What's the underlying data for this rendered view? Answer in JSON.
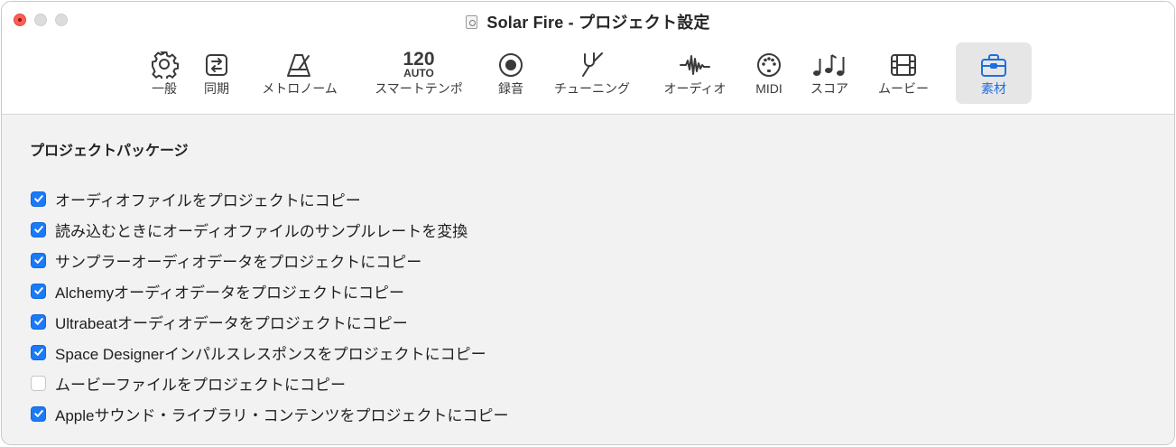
{
  "window": {
    "title": "Solar Fire - プロジェクト設定"
  },
  "toolbar": {
    "tempo_number": "120",
    "tempo_mode": "AUTO",
    "items": [
      {
        "label": "一般",
        "icon": "gear-icon"
      },
      {
        "label": "同期",
        "icon": "sync-icon"
      },
      {
        "label": "メトロノーム",
        "icon": "metronome-icon"
      },
      {
        "label": "スマートテンポ",
        "icon": "smart-tempo-icon"
      },
      {
        "label": "録音",
        "icon": "record-icon"
      },
      {
        "label": "チューニング",
        "icon": "tuning-fork-icon"
      },
      {
        "label": "オーディオ",
        "icon": "waveform-icon"
      },
      {
        "label": "MIDI",
        "icon": "midi-connector-icon"
      },
      {
        "label": "スコア",
        "icon": "music-notes-icon"
      },
      {
        "label": "ムービー",
        "icon": "film-icon"
      },
      {
        "label": "素材",
        "icon": "briefcase-icon",
        "selected": true
      }
    ]
  },
  "colors": {
    "accent": "#1a7af8",
    "selected_tab_text": "#1d6fe0",
    "selected_tab_bg": "#e6e6e6"
  },
  "section": {
    "title": "プロジェクトパッケージ",
    "options": [
      {
        "label": "オーディオファイルをプロジェクトにコピー",
        "checked": true
      },
      {
        "label": "読み込むときにオーディオファイルのサンプルレートを変換",
        "checked": true
      },
      {
        "label": "サンプラーオーディオデータをプロジェクトにコピー",
        "checked": true
      },
      {
        "label": "Alchemyオーディオデータをプロジェクトにコピー",
        "checked": true
      },
      {
        "label": "Ultrabeatオーディオデータをプロジェクトにコピー",
        "checked": true
      },
      {
        "label": "Space Designerインパルスレスポンスをプロジェクトにコピー",
        "checked": true
      },
      {
        "label": "ムービーファイルをプロジェクトにコピー",
        "checked": false
      },
      {
        "label": "Appleサウンド・ライブラリ・コンテンツをプロジェクトにコピー",
        "checked": true
      }
    ]
  }
}
